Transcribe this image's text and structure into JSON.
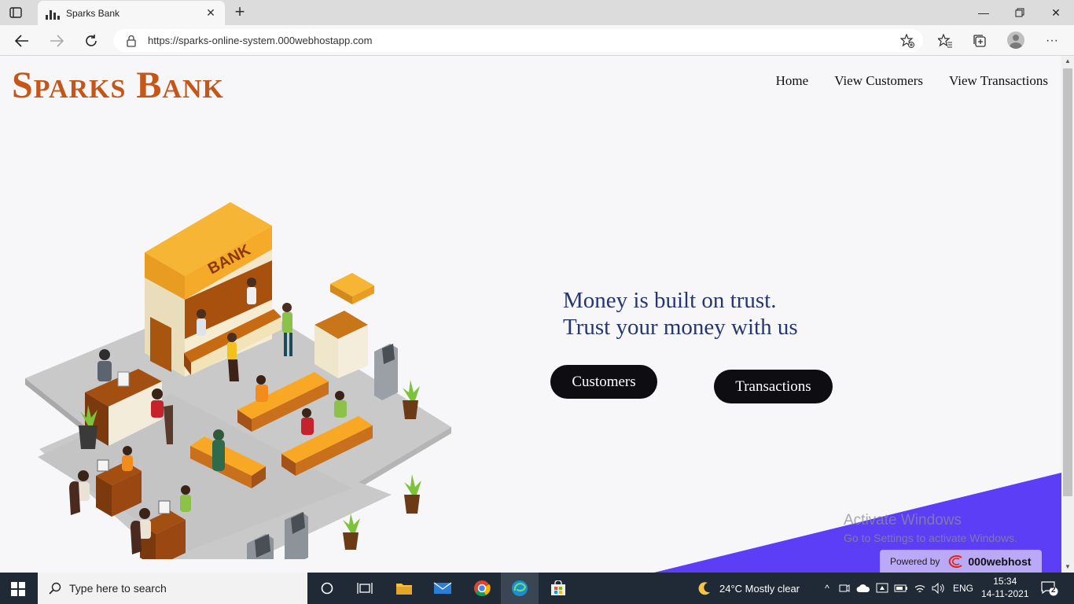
{
  "browser": {
    "tab_title": "Sparks Bank",
    "url": "https://sparks-online-system.000webhostapp.com"
  },
  "page": {
    "brand": "Sparks Bank",
    "nav": [
      "Home",
      "View Customers",
      "View Transactions"
    ],
    "illustration_sign": "BANK",
    "hero_line1": "Money is built on trust.",
    "hero_line2": "Trust your money with us",
    "btn_customers": "Customers",
    "btn_transactions": "Transactions"
  },
  "overlay": {
    "activate_title": "Activate Windows",
    "activate_sub": "Go to Settings to activate Windows.",
    "powered_by": "Powered by",
    "host_name": "000webhost"
  },
  "taskbar": {
    "search_placeholder": "Type here to search",
    "weather": "24°C  Mostly clear",
    "lang": "ENG",
    "time": "15:34",
    "date": "14-11-2021",
    "notifications": "2"
  },
  "colors": {
    "brand": "#c4561a",
    "hero_text": "#26366e",
    "button_bg": "#0e0e12",
    "accent_purple": "#5b3ef5"
  }
}
